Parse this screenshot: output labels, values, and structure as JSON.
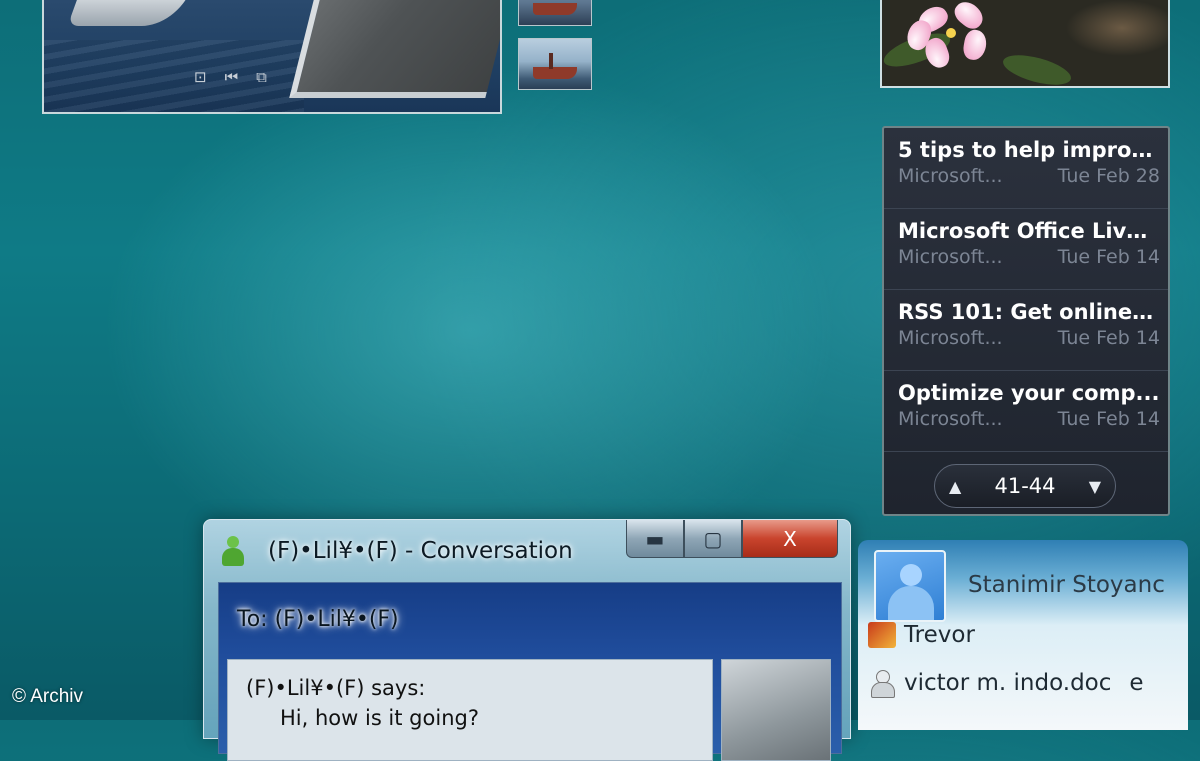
{
  "rss": {
    "items": [
      {
        "title": "5 tips to help improv...",
        "source": "Microsoft...",
        "date": "Tue Feb 28"
      },
      {
        "title": "Microsoft Office Live...",
        "source": "Microsoft...",
        "date": "Tue Feb 14"
      },
      {
        "title": "RSS 101: Get online ...",
        "source": "Microsoft...",
        "date": "Tue Feb 14"
      },
      {
        "title": "Optimize your comp...",
        "source": "Microsoft...",
        "date": "Tue Feb 14"
      }
    ],
    "pager": {
      "range": "41-44",
      "up_icon": "triangle-up-icon",
      "down_icon": "triangle-down-icon"
    }
  },
  "conversation": {
    "title": "(F)•Lil¥•(F) - Conversation",
    "to_line": "To: (F)•Lil¥•(F)",
    "says_line": "(F)•Lil¥•(F) says:",
    "message": "Hi, how is it going?",
    "buttons": {
      "minimize": "▬",
      "maximize": "▢",
      "close": "X"
    }
  },
  "contacts": {
    "user_name": "Stanimir Stoyanc",
    "list": [
      {
        "name": "Trevor"
      },
      {
        "name": "victor m. indo.doc",
        "suffix": "e"
      }
    ]
  },
  "slideshow": {
    "controls": [
      "⊡",
      "⏮",
      "⧉"
    ]
  },
  "watermark": "© Archiv"
}
